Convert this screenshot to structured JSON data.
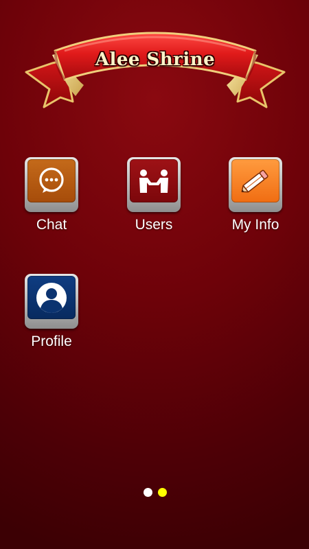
{
  "header": {
    "title": "Alee Shrine",
    "banner_icon": "ribbon-banner"
  },
  "apps": [
    {
      "label": "Chat",
      "icon": "chat-bubble-icon",
      "color": "#b5580f"
    },
    {
      "label": "Users",
      "icon": "handshake-icon",
      "color": "#8b0c10"
    },
    {
      "label": "My Info",
      "icon": "pencil-icon",
      "color": "#f7812a"
    },
    {
      "label": "Profile",
      "icon": "user-avatar-icon",
      "color": "#0b3370"
    }
  ],
  "pager": {
    "pages": 2,
    "active_page": 2,
    "inactive_color": "#ffffff",
    "active_color": "#ffff00"
  },
  "colors": {
    "background": "#6e0209",
    "label_text": "#ffffff"
  }
}
